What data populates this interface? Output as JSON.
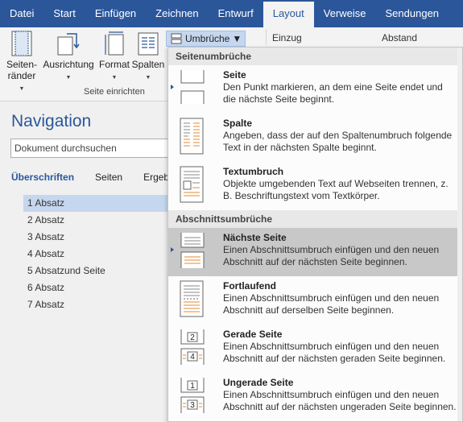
{
  "tabs": [
    "Datei",
    "Start",
    "Einfügen",
    "Zeichnen",
    "Entwurf",
    "Layout",
    "Verweise",
    "Sendungen"
  ],
  "ribbon": {
    "seitenraender": [
      "Seiten-",
      "ränder"
    ],
    "ausrichtung": "Ausrichtung",
    "format": "Format",
    "spalten": "Spalten",
    "group_label": "Seite einrichten",
    "umbrueche": "Umbrüche",
    "einzug": "Einzug",
    "abstand": "Abstand"
  },
  "nav": {
    "title": "Navigation",
    "search_placeholder": "Dokument durchsuchen",
    "tabs": [
      "Überschriften",
      "Seiten",
      "Ergeb"
    ],
    "items": [
      "1 Absatz",
      "2 Absatz",
      "3 Absatz",
      "4 Absatz",
      "5 Absatzund Seite",
      "6 Absatz",
      "7 Absatz"
    ]
  },
  "menu": {
    "section1": "Seitenumbrüche",
    "section2": "Abschnittsumbrüche",
    "items": [
      {
        "title": "Seite",
        "desc": "Den Punkt markieren, an dem eine Seite endet und die nächste Seite beginnt."
      },
      {
        "title": "Spalte",
        "desc": "Angeben, dass der auf den Spaltenumbruch folgende Text in der nächsten Spalte beginnt."
      },
      {
        "title": "Textumbruch",
        "desc": "Objekte umgebenden Text auf Webseiten trennen, z. B. Beschriftungstext vom Textkörper."
      },
      {
        "title": "Nächste Seite",
        "desc": "Einen Abschnittsumbruch einfügen und den neuen Abschnitt auf der nächsten Seite beginnen."
      },
      {
        "title": "Fortlaufend",
        "desc": "Einen Abschnittsumbruch einfügen und den neuen Abschnitt auf derselben Seite beginnen."
      },
      {
        "title": "Gerade Seite",
        "desc": "Einen Abschnittsumbruch einfügen und den neuen Abschnitt auf der nächsten geraden Seite beginnen."
      },
      {
        "title": "Ungerade Seite",
        "desc": "Einen Abschnittsumbruch einfügen und den neuen Abschnitt auf der nächsten ungeraden Seite beginnen."
      }
    ],
    "icon_numbers": [
      "2",
      "4",
      "1",
      "3"
    ]
  },
  "colors": {
    "accent": "#2b579a",
    "highlight": "#c8c8c8",
    "selection": "#c5d7ee",
    "orange": "#e48b2c"
  }
}
